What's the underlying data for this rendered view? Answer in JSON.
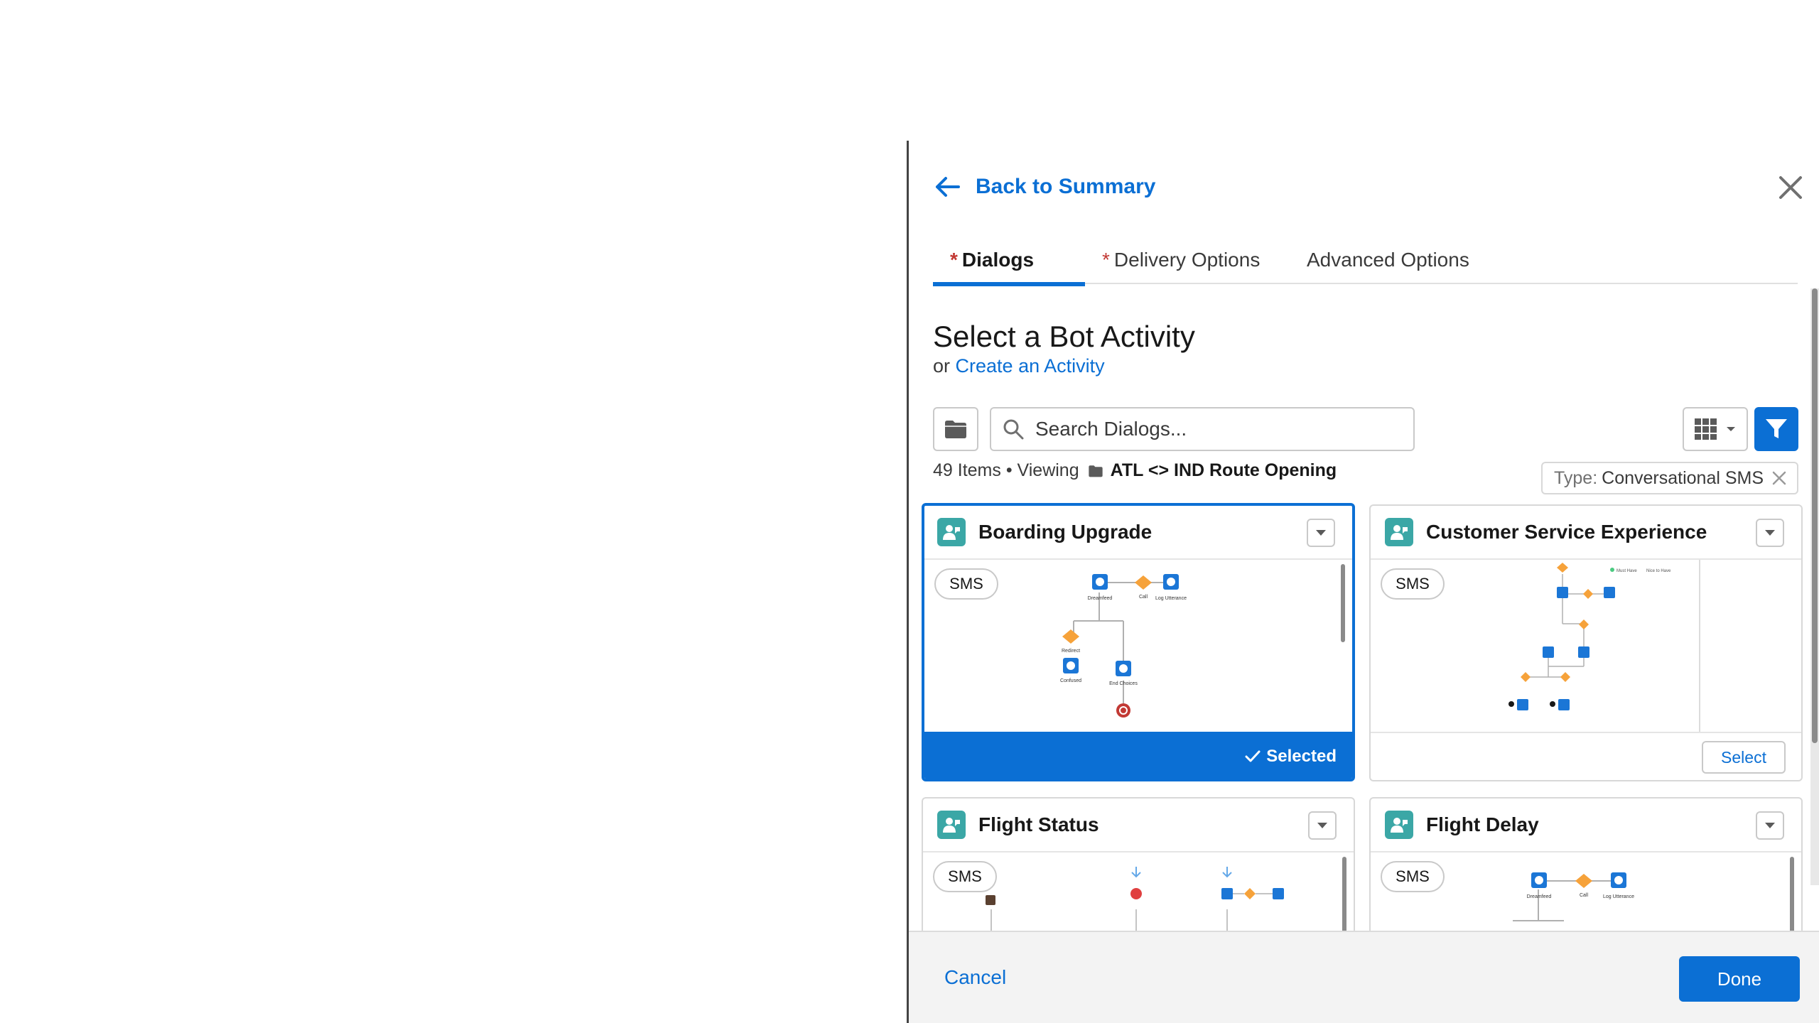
{
  "header": {
    "back_label": "Back to Summary"
  },
  "tabs": [
    {
      "label": "Dialogs",
      "required": "*"
    },
    {
      "label": "Delivery Options",
      "required": "*"
    },
    {
      "label": "Advanced Options"
    }
  ],
  "content": {
    "title": "Select a Bot Activity",
    "sub_prefix": "or",
    "sub_link": "Create an Activity"
  },
  "search": {
    "placeholder": "Search Dialogs..."
  },
  "info": {
    "count": "49 Items • Viewing",
    "folder": "ATL <> IND Route Opening"
  },
  "filter": {
    "label": "Type:",
    "value": "Conversational SMS"
  },
  "cards": [
    {
      "title": "Boarding Upgrade",
      "badge": "SMS",
      "footer": "Selected"
    },
    {
      "title": "Customer Service Experience",
      "badge": "SMS",
      "footer": "Select"
    },
    {
      "title": "Flight Status",
      "badge": "SMS"
    },
    {
      "title": "Flight Delay",
      "badge": "SMS"
    }
  ],
  "footer": {
    "cancel_label": "Cancel",
    "done_label": "Done"
  },
  "colors": {
    "accent": "#0b6fd4",
    "bot_icon": "#3ba7a6",
    "required": "#c23934"
  }
}
